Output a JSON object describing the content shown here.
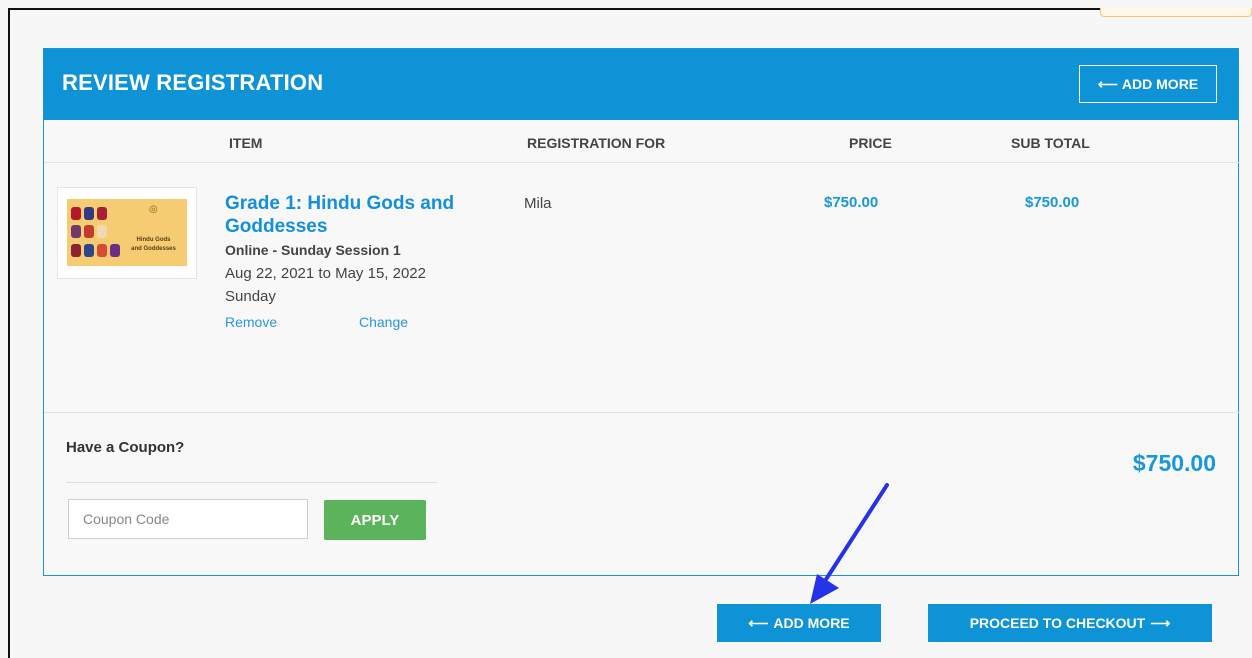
{
  "registration": {
    "title": "REVIEW REGISTRATION",
    "add_more_label": "ADD MORE",
    "add_more_icon": "left-arrow",
    "columns": [
      "ITEM",
      "REGISTRATION FOR",
      "PRICE",
      "SUB TOTAL"
    ]
  },
  "item": {
    "thumbnail_title_line1": "Hindu Gods",
    "thumbnail_title_line2": "and Goddesses",
    "title": "Grade 1: Hindu Gods and Goddesses",
    "session": "Online - Sunday Session 1",
    "dates": "Aug 22, 2021 to May 15, 2022",
    "day": "Sunday",
    "remove_label": "Remove",
    "change_label": "Change",
    "registration_for": "Mila",
    "price": "$750.00",
    "subtotal": "$750.00"
  },
  "coupon": {
    "label": "Have a Coupon?",
    "placeholder": "Coupon Code",
    "apply_label": "APPLY"
  },
  "total": "$750.00",
  "footer": {
    "add_more_label": "ADD MORE",
    "checkout_label": "PROCEED TO CHECKOUT",
    "checkout_icon": "right-arrow"
  },
  "colors": {
    "primary": "#0d93d6",
    "link": "#2c97dd",
    "success": "#5bb45b",
    "annotation": "#2433e8"
  }
}
